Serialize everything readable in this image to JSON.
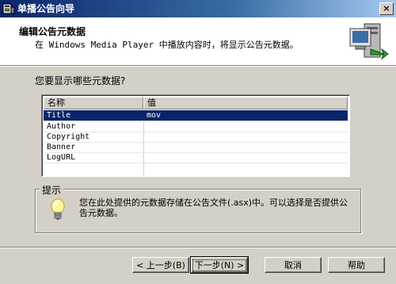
{
  "window": {
    "title": "单播公告向导",
    "close_label": "×"
  },
  "header": {
    "title": "编辑公告元数据",
    "subtitle": "在 Windows Media Player 中播放内容时，将显示公告元数据。"
  },
  "question": "您要显示哪些元数据?",
  "table": {
    "columns": [
      "名称",
      "值"
    ],
    "rows": [
      {
        "name": "Title",
        "value": "mov",
        "selected": true
      },
      {
        "name": "Author",
        "value": ""
      },
      {
        "name": "Copyright",
        "value": ""
      },
      {
        "name": "Banner",
        "value": ""
      },
      {
        "name": "LogURL",
        "value": ""
      }
    ]
  },
  "tip": {
    "label": "提示",
    "text": "您在此处提供的元数据存储在公告文件(.asx)中。可以选择是否提供公告元数据。"
  },
  "buttons": {
    "back": "< 上一步(B)",
    "next": "下一步(N) >",
    "cancel": "取消",
    "help": "帮助"
  }
}
